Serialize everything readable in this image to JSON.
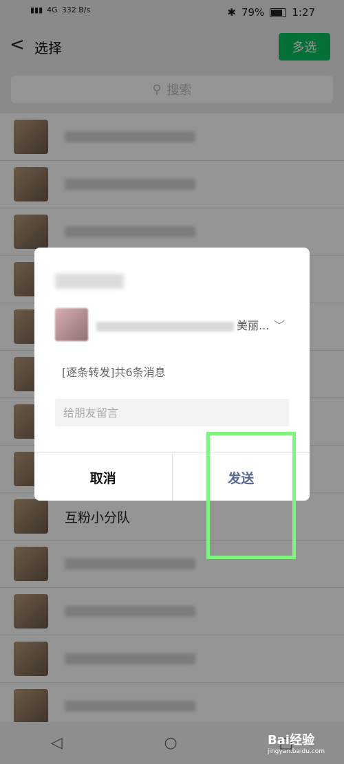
{
  "statusbar": {
    "network": "4G",
    "speed": "332 B/s",
    "battery": "79%",
    "time": "1:27"
  },
  "header": {
    "title": "选择",
    "multi_select_label": "多选"
  },
  "search": {
    "placeholder": "搜索"
  },
  "list": {
    "visible_name": "互粉小分队"
  },
  "dialog": {
    "target_suffix": "美丽...",
    "summary": "[逐条转发]共6条消息",
    "comment_placeholder": "给朋友留言",
    "cancel_label": "取消",
    "send_label": "发送"
  },
  "watermark": {
    "brand": "Bai经验",
    "url": "jingyan.baidu.com"
  },
  "colors": {
    "accent_green": "#07c160",
    "send_blue": "#576b95",
    "highlight": "#7ff47f"
  }
}
